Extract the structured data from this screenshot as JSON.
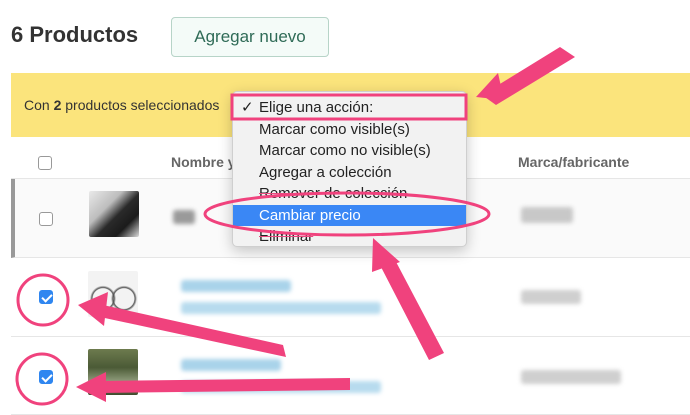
{
  "header": {
    "title": "6 Productos",
    "add_button": "Agregar nuevo"
  },
  "banner": {
    "prefix": "Con ",
    "count": "2",
    "suffix": " productos seleccionados"
  },
  "table": {
    "col_name": "Nombre y",
    "col_brand": "Marca/fabricante"
  },
  "dropdown": {
    "items": [
      {
        "label": "Elige una acción:",
        "checked": true
      },
      {
        "label": "Marcar como visible(s)"
      },
      {
        "label": "Marcar como no visible(s)"
      },
      {
        "label": "Agregar a colección"
      },
      {
        "label": "Remover de colección"
      },
      {
        "label": "Cambiar precio",
        "highlighted": true
      },
      {
        "label": "Eliminar"
      }
    ],
    "check_glyph": "✓"
  },
  "rows": [
    {
      "checked": false,
      "thumb": "product-shoe-thumbnail"
    },
    {
      "checked": true,
      "thumb": "product-bicycle-thumbnail"
    },
    {
      "checked": true,
      "thumb": "product-outdoor-thumbnail"
    }
  ],
  "colors": {
    "accent_pink": "#f0427d",
    "banner_yellow": "#fbe47c",
    "highlight_blue": "#3a87f5"
  }
}
